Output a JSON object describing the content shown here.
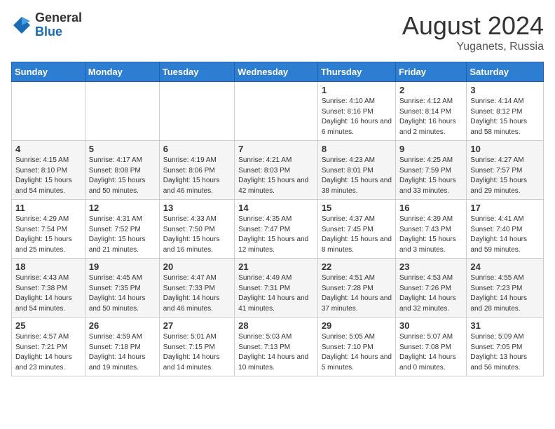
{
  "header": {
    "logo_general": "General",
    "logo_blue": "Blue",
    "month_title": "August 2024",
    "location": "Yuganets, Russia"
  },
  "weekdays": [
    "Sunday",
    "Monday",
    "Tuesday",
    "Wednesday",
    "Thursday",
    "Friday",
    "Saturday"
  ],
  "weeks": [
    [
      {
        "day": "",
        "sunrise": "",
        "sunset": "",
        "daylight": ""
      },
      {
        "day": "",
        "sunrise": "",
        "sunset": "",
        "daylight": ""
      },
      {
        "day": "",
        "sunrise": "",
        "sunset": "",
        "daylight": ""
      },
      {
        "day": "",
        "sunrise": "",
        "sunset": "",
        "daylight": ""
      },
      {
        "day": "1",
        "sunrise": "Sunrise: 4:10 AM",
        "sunset": "Sunset: 8:16 PM",
        "daylight": "Daylight: 16 hours and 6 minutes."
      },
      {
        "day": "2",
        "sunrise": "Sunrise: 4:12 AM",
        "sunset": "Sunset: 8:14 PM",
        "daylight": "Daylight: 16 hours and 2 minutes."
      },
      {
        "day": "3",
        "sunrise": "Sunrise: 4:14 AM",
        "sunset": "Sunset: 8:12 PM",
        "daylight": "Daylight: 15 hours and 58 minutes."
      }
    ],
    [
      {
        "day": "4",
        "sunrise": "Sunrise: 4:15 AM",
        "sunset": "Sunset: 8:10 PM",
        "daylight": "Daylight: 15 hours and 54 minutes."
      },
      {
        "day": "5",
        "sunrise": "Sunrise: 4:17 AM",
        "sunset": "Sunset: 8:08 PM",
        "daylight": "Daylight: 15 hours and 50 minutes."
      },
      {
        "day": "6",
        "sunrise": "Sunrise: 4:19 AM",
        "sunset": "Sunset: 8:06 PM",
        "daylight": "Daylight: 15 hours and 46 minutes."
      },
      {
        "day": "7",
        "sunrise": "Sunrise: 4:21 AM",
        "sunset": "Sunset: 8:03 PM",
        "daylight": "Daylight: 15 hours and 42 minutes."
      },
      {
        "day": "8",
        "sunrise": "Sunrise: 4:23 AM",
        "sunset": "Sunset: 8:01 PM",
        "daylight": "Daylight: 15 hours and 38 minutes."
      },
      {
        "day": "9",
        "sunrise": "Sunrise: 4:25 AM",
        "sunset": "Sunset: 7:59 PM",
        "daylight": "Daylight: 15 hours and 33 minutes."
      },
      {
        "day": "10",
        "sunrise": "Sunrise: 4:27 AM",
        "sunset": "Sunset: 7:57 PM",
        "daylight": "Daylight: 15 hours and 29 minutes."
      }
    ],
    [
      {
        "day": "11",
        "sunrise": "Sunrise: 4:29 AM",
        "sunset": "Sunset: 7:54 PM",
        "daylight": "Daylight: 15 hours and 25 minutes."
      },
      {
        "day": "12",
        "sunrise": "Sunrise: 4:31 AM",
        "sunset": "Sunset: 7:52 PM",
        "daylight": "Daylight: 15 hours and 21 minutes."
      },
      {
        "day": "13",
        "sunrise": "Sunrise: 4:33 AM",
        "sunset": "Sunset: 7:50 PM",
        "daylight": "Daylight: 15 hours and 16 minutes."
      },
      {
        "day": "14",
        "sunrise": "Sunrise: 4:35 AM",
        "sunset": "Sunset: 7:47 PM",
        "daylight": "Daylight: 15 hours and 12 minutes."
      },
      {
        "day": "15",
        "sunrise": "Sunrise: 4:37 AM",
        "sunset": "Sunset: 7:45 PM",
        "daylight": "Daylight: 15 hours and 8 minutes."
      },
      {
        "day": "16",
        "sunrise": "Sunrise: 4:39 AM",
        "sunset": "Sunset: 7:43 PM",
        "daylight": "Daylight: 15 hours and 3 minutes."
      },
      {
        "day": "17",
        "sunrise": "Sunrise: 4:41 AM",
        "sunset": "Sunset: 7:40 PM",
        "daylight": "Daylight: 14 hours and 59 minutes."
      }
    ],
    [
      {
        "day": "18",
        "sunrise": "Sunrise: 4:43 AM",
        "sunset": "Sunset: 7:38 PM",
        "daylight": "Daylight: 14 hours and 54 minutes."
      },
      {
        "day": "19",
        "sunrise": "Sunrise: 4:45 AM",
        "sunset": "Sunset: 7:35 PM",
        "daylight": "Daylight: 14 hours and 50 minutes."
      },
      {
        "day": "20",
        "sunrise": "Sunrise: 4:47 AM",
        "sunset": "Sunset: 7:33 PM",
        "daylight": "Daylight: 14 hours and 46 minutes."
      },
      {
        "day": "21",
        "sunrise": "Sunrise: 4:49 AM",
        "sunset": "Sunset: 7:31 PM",
        "daylight": "Daylight: 14 hours and 41 minutes."
      },
      {
        "day": "22",
        "sunrise": "Sunrise: 4:51 AM",
        "sunset": "Sunset: 7:28 PM",
        "daylight": "Daylight: 14 hours and 37 minutes."
      },
      {
        "day": "23",
        "sunrise": "Sunrise: 4:53 AM",
        "sunset": "Sunset: 7:26 PM",
        "daylight": "Daylight: 14 hours and 32 minutes."
      },
      {
        "day": "24",
        "sunrise": "Sunrise: 4:55 AM",
        "sunset": "Sunset: 7:23 PM",
        "daylight": "Daylight: 14 hours and 28 minutes."
      }
    ],
    [
      {
        "day": "25",
        "sunrise": "Sunrise: 4:57 AM",
        "sunset": "Sunset: 7:21 PM",
        "daylight": "Daylight: 14 hours and 23 minutes."
      },
      {
        "day": "26",
        "sunrise": "Sunrise: 4:59 AM",
        "sunset": "Sunset: 7:18 PM",
        "daylight": "Daylight: 14 hours and 19 minutes."
      },
      {
        "day": "27",
        "sunrise": "Sunrise: 5:01 AM",
        "sunset": "Sunset: 7:15 PM",
        "daylight": "Daylight: 14 hours and 14 minutes."
      },
      {
        "day": "28",
        "sunrise": "Sunrise: 5:03 AM",
        "sunset": "Sunset: 7:13 PM",
        "daylight": "Daylight: 14 hours and 10 minutes."
      },
      {
        "day": "29",
        "sunrise": "Sunrise: 5:05 AM",
        "sunset": "Sunset: 7:10 PM",
        "daylight": "Daylight: 14 hours and 5 minutes."
      },
      {
        "day": "30",
        "sunrise": "Sunrise: 5:07 AM",
        "sunset": "Sunset: 7:08 PM",
        "daylight": "Daylight: 14 hours and 0 minutes."
      },
      {
        "day": "31",
        "sunrise": "Sunrise: 5:09 AM",
        "sunset": "Sunset: 7:05 PM",
        "daylight": "Daylight: 13 hours and 56 minutes."
      }
    ]
  ]
}
